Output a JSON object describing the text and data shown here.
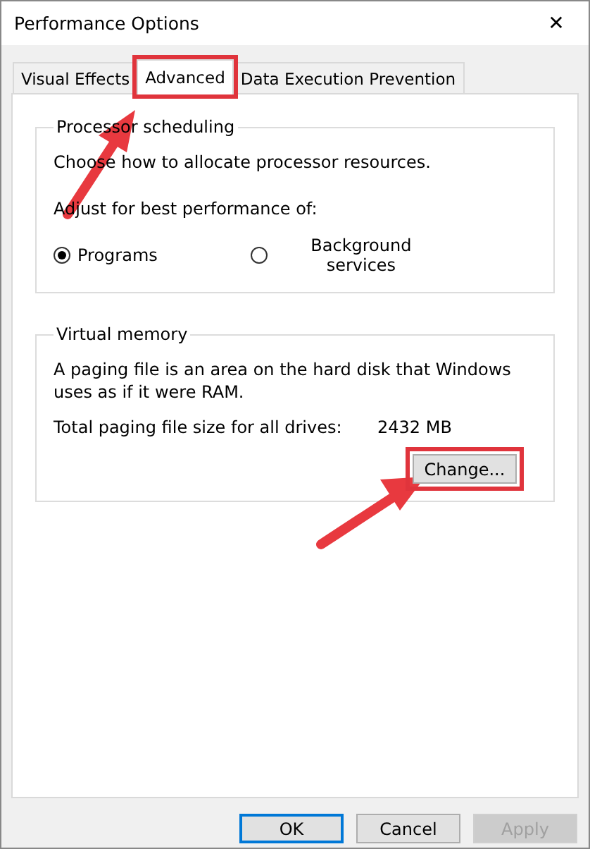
{
  "window": {
    "title": "Performance Options",
    "close": "✕"
  },
  "tabs": [
    {
      "label": "Visual Effects",
      "selected": false,
      "highlighted": false
    },
    {
      "label": "Advanced",
      "selected": true,
      "highlighted": true
    },
    {
      "label": "Data Execution Prevention",
      "selected": false,
      "highlighted": false
    }
  ],
  "processor_scheduling": {
    "title": "Processor scheduling",
    "description": "Choose how to allocate processor resources.",
    "prompt": "Adjust for best performance of:",
    "options": [
      {
        "label": "Programs",
        "selected": true
      },
      {
        "label": "Background services",
        "selected": false
      }
    ]
  },
  "virtual_memory": {
    "title": "Virtual memory",
    "description": "A paging file is an area on the hard disk that Windows uses as if it were RAM.",
    "total_label": "Total paging file size for all drives:",
    "total_value": "2432 MB",
    "change_button": {
      "label": "Change...",
      "highlighted": true
    }
  },
  "buttons": [
    {
      "label": "OK",
      "default": true,
      "disabled": false
    },
    {
      "label": "Cancel",
      "default": false,
      "disabled": false
    },
    {
      "label": "Apply",
      "default": false,
      "disabled": true
    }
  ]
}
